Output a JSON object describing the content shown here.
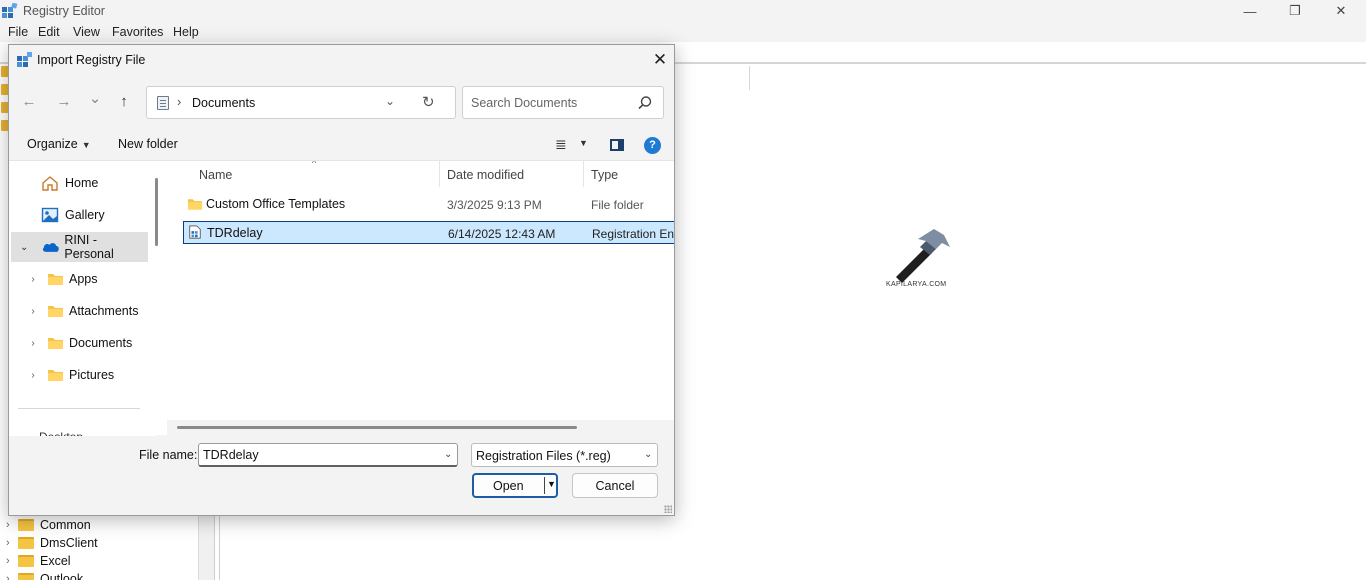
{
  "registry": {
    "title": "Registry Editor",
    "menu": [
      "File",
      "Edit",
      "View",
      "Favorites",
      "Help"
    ],
    "window_controls": {
      "minimize": "—",
      "maximize": "❐",
      "close": "✕"
    },
    "tree_items": [
      "Common",
      "DmsClient",
      "Excel",
      "Outlook"
    ]
  },
  "watermark": {
    "text": "KAPILARYA.COM"
  },
  "dialog": {
    "title": "Import Registry File",
    "close_glyph": "✕",
    "nav": {
      "back": "←",
      "forward": "→",
      "recent": "⌄",
      "up": "↑"
    },
    "address": {
      "separator": "›",
      "location": "Documents",
      "dropdown": "⌄",
      "refresh": "↻"
    },
    "search": {
      "placeholder": "Search Documents"
    },
    "toolbar": {
      "organize": "Organize",
      "new_folder": "New folder",
      "view_icon": "≣",
      "view_dd": "▼",
      "help": "?"
    },
    "nav_pane": [
      {
        "label": "Home",
        "icon": "home-icon"
      },
      {
        "label": "Gallery",
        "icon": "gallery-icon"
      },
      {
        "label": "RINI - Personal",
        "icon": "onedrive-cloud-icon",
        "expanded": true,
        "selected": true
      },
      {
        "label": "Apps",
        "icon": "folder-icon"
      },
      {
        "label": "Attachments",
        "icon": "folder-icon"
      },
      {
        "label": "Documents",
        "icon": "folder-icon"
      },
      {
        "label": "Pictures",
        "icon": "folder-icon"
      }
    ],
    "nav_partial": "Desktop",
    "columns": {
      "name": "Name",
      "date": "Date modified",
      "type": "Type",
      "sort": "^"
    },
    "files": [
      {
        "name": "Custom Office Templates",
        "date": "3/3/2025 9:13 PM",
        "type": "File folder",
        "icon": "folder-icon"
      },
      {
        "name": "TDRdelay",
        "date": "6/14/2025 12:43 AM",
        "type": "Registration Entries",
        "icon": "reg-file-icon",
        "selected": true
      }
    ],
    "filename": {
      "label": "File name:",
      "value": "TDRdelay",
      "dropdown": "⌄"
    },
    "filter": {
      "selected": "Registration Files (*.reg)",
      "dropdown": "⌄"
    },
    "buttons": {
      "open": "Open",
      "open_dd": "▼",
      "cancel": "Cancel"
    }
  },
  "colors": {
    "accent": "#1e5da6",
    "selection": "#cce8ff",
    "folder": "#f4c542",
    "help": "#1f7ad4"
  }
}
